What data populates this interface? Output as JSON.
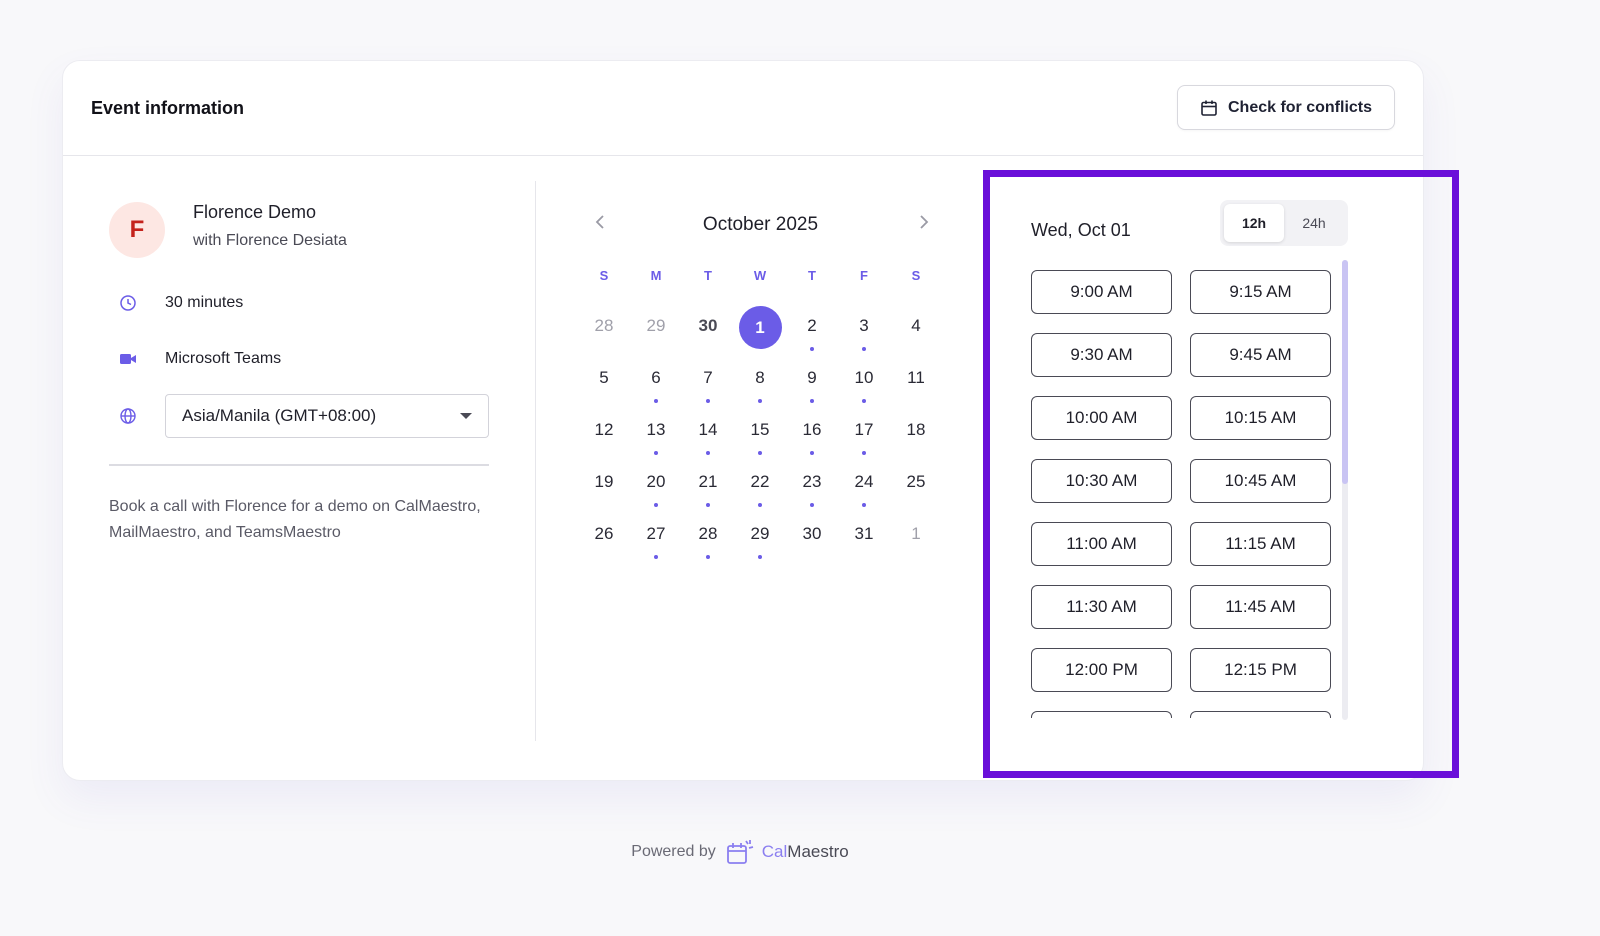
{
  "header": {
    "title": "Event information",
    "conflicts_label": "Check for conflicts"
  },
  "host": {
    "initial": "F",
    "event_name": "Florence Demo",
    "subtitle": "with Florence Desiata",
    "duration": "30 minutes",
    "location": "Microsoft Teams",
    "timezone": "Asia/Manila (GMT+08:00)",
    "description": "Book a call with Florence for a demo on CalMaestro, MailMaestro, and TeamsMaestro"
  },
  "calendar": {
    "month_title": "October 2025",
    "weekdays": [
      "S",
      "M",
      "T",
      "W",
      "T",
      "F",
      "S"
    ],
    "weeks": [
      [
        {
          "d": "28",
          "o": true
        },
        {
          "d": "29",
          "o": true
        },
        {
          "d": "30",
          "o": true,
          "b": true
        },
        {
          "d": "1",
          "sel": true
        },
        {
          "d": "2",
          "dot": true
        },
        {
          "d": "3",
          "dot": true
        },
        {
          "d": "4"
        }
      ],
      [
        {
          "d": "5"
        },
        {
          "d": "6",
          "dot": true
        },
        {
          "d": "7",
          "dot": true
        },
        {
          "d": "8",
          "dot": true
        },
        {
          "d": "9",
          "dot": true
        },
        {
          "d": "10",
          "dot": true
        },
        {
          "d": "11"
        }
      ],
      [
        {
          "d": "12"
        },
        {
          "d": "13",
          "dot": true
        },
        {
          "d": "14",
          "dot": true
        },
        {
          "d": "15",
          "dot": true
        },
        {
          "d": "16",
          "dot": true
        },
        {
          "d": "17",
          "dot": true
        },
        {
          "d": "18"
        }
      ],
      [
        {
          "d": "19"
        },
        {
          "d": "20",
          "dot": true
        },
        {
          "d": "21",
          "dot": true
        },
        {
          "d": "22",
          "dot": true
        },
        {
          "d": "23",
          "dot": true
        },
        {
          "d": "24",
          "dot": true
        },
        {
          "d": "25"
        }
      ],
      [
        {
          "d": "26"
        },
        {
          "d": "27",
          "dot": true
        },
        {
          "d": "28",
          "dot": true
        },
        {
          "d": "29",
          "dot": true
        },
        {
          "d": "30"
        },
        {
          "d": "31"
        },
        {
          "d": "1",
          "o": true
        }
      ]
    ]
  },
  "slots": {
    "date_label": "Wed, Oct 01",
    "format_12h": "12h",
    "format_24h": "24h",
    "times": [
      "9:00 AM",
      "9:15 AM",
      "9:30 AM",
      "9:45 AM",
      "10:00 AM",
      "10:15 AM",
      "10:30 AM",
      "10:45 AM",
      "11:00 AM",
      "11:15 AM",
      "11:30 AM",
      "11:45 AM",
      "12:00 PM",
      "12:15 PM",
      "",
      ""
    ]
  },
  "footer": {
    "powered_by": "Powered by",
    "brand_cal": "Cal",
    "brand_maestro": "Maestro"
  },
  "colors": {
    "accent": "#6b5ce7",
    "highlight": "#6a0fd9",
    "avatar_bg": "#fde7e3",
    "avatar_fg": "#c4221b"
  }
}
